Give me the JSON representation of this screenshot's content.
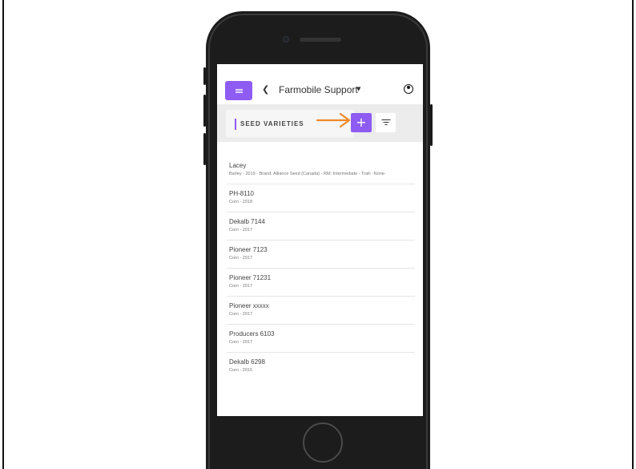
{
  "app": {
    "title": "Farmobile Support",
    "icons": {
      "menu": "hamburger-menu-icon",
      "back": "chevron-left-icon",
      "dropdown": "caret-down-icon",
      "account": "account-circle-icon",
      "add": "plus-icon",
      "filter": "filter-icon",
      "annotation": "arrow-right-icon"
    },
    "colors": {
      "accent": "#8e5cf2",
      "annotation_arrow": "#ee8a2a"
    }
  },
  "toolbar": {
    "section_title": "SEED VARIETIES",
    "add_label": "+"
  },
  "seed_varieties": [
    {
      "name": "Lacey",
      "details": "Barley - 2019 - Brand: Alliance Seed (Canada) - RM: Intermediate - Trait: -None-"
    },
    {
      "name": "PH-8110",
      "details": "Corn - 2018"
    },
    {
      "name": "Dekalb 7144",
      "details": "Corn - 2017"
    },
    {
      "name": "Pioneer 7123",
      "details": "Corn - 2017"
    },
    {
      "name": "Pioneer 71231",
      "details": "Corn - 2017"
    },
    {
      "name": "Pioneer xxxxx",
      "details": "Corn - 2017"
    },
    {
      "name": "Producers 6103",
      "details": "Corn - 2017"
    },
    {
      "name": "Dekalb 6298",
      "details": "Corn - 2016"
    }
  ]
}
